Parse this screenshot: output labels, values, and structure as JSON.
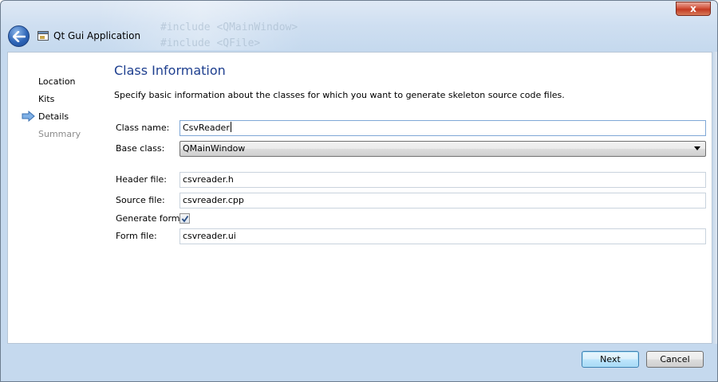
{
  "window": {
    "title": "Qt Gui Application",
    "close_label": "x",
    "background_code": [
      "#include <QMainWindow>",
      "#include <QFile>"
    ]
  },
  "nav": {
    "items": [
      {
        "label": "Location",
        "state": "done"
      },
      {
        "label": "Kits",
        "state": "done"
      },
      {
        "label": "Details",
        "state": "current"
      },
      {
        "label": "Summary",
        "state": "pending"
      }
    ]
  },
  "page": {
    "title": "Class Information",
    "description": "Specify basic information about the classes for which you want to generate skeleton source code files."
  },
  "form": {
    "class_name": {
      "label": "Class name:",
      "value": "CsvReader"
    },
    "base_class": {
      "label": "Base class:",
      "value": "QMainWindow"
    },
    "header_file": {
      "label": "Header file:",
      "value": "csvreader.h"
    },
    "source_file": {
      "label": "Source file:",
      "value": "csvreader.cpp"
    },
    "generate_form": {
      "label": "Generate form:",
      "checked": true
    },
    "form_file": {
      "label": "Form file:",
      "value": "csvreader.ui"
    }
  },
  "footer": {
    "next_label": "Next",
    "cancel_label": "Cancel"
  },
  "colors": {
    "title_blue": "#1e3f8f",
    "accent": "#3c7fb1"
  }
}
